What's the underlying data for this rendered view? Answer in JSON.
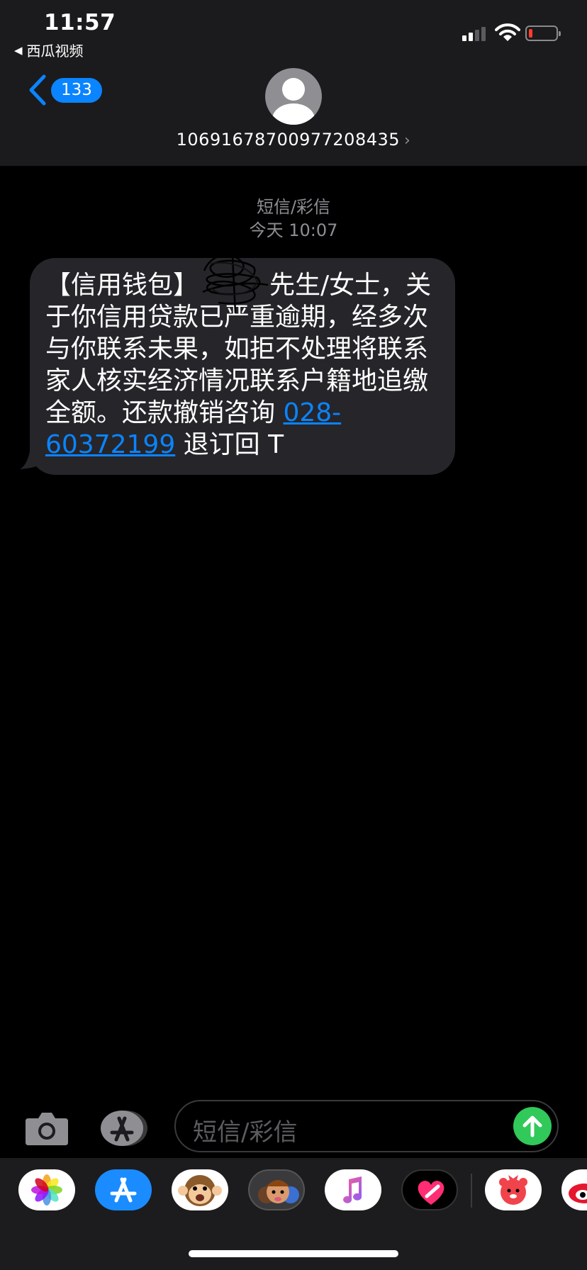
{
  "status_bar": {
    "time": "11:57",
    "back_app": "西瓜视频",
    "signal_bars": 2,
    "battery_level": 0.12
  },
  "nav": {
    "back_count": "133",
    "sender_number": "106916787009772084​35"
  },
  "conversation": {
    "message_type": "短信/彩信",
    "date": "今天 10:07",
    "message": {
      "before_link": "【信用钱包】",
      "body": "先生/女士，关于你信用贷款已严重逾期，经多次与你联系未果，如拒不处理将联系家人核实经济情况联系户籍地追缴全额。还款撤销咨询",
      "link": "028-60372199",
      "after_link": " 退订回 T"
    }
  },
  "input": {
    "placeholder": "短信/彩信"
  },
  "drawer": {
    "apps": [
      "photos-icon",
      "app-store-icon",
      "animoji-icon",
      "memoji-icon",
      "music-icon",
      "digital-touch-icon",
      "red-app-icon",
      "weibo-icon"
    ]
  },
  "colors": {
    "accent": "#0a84ff",
    "send": "#30c95a",
    "bubble": "#26252a",
    "header": "#1b1b1d"
  }
}
